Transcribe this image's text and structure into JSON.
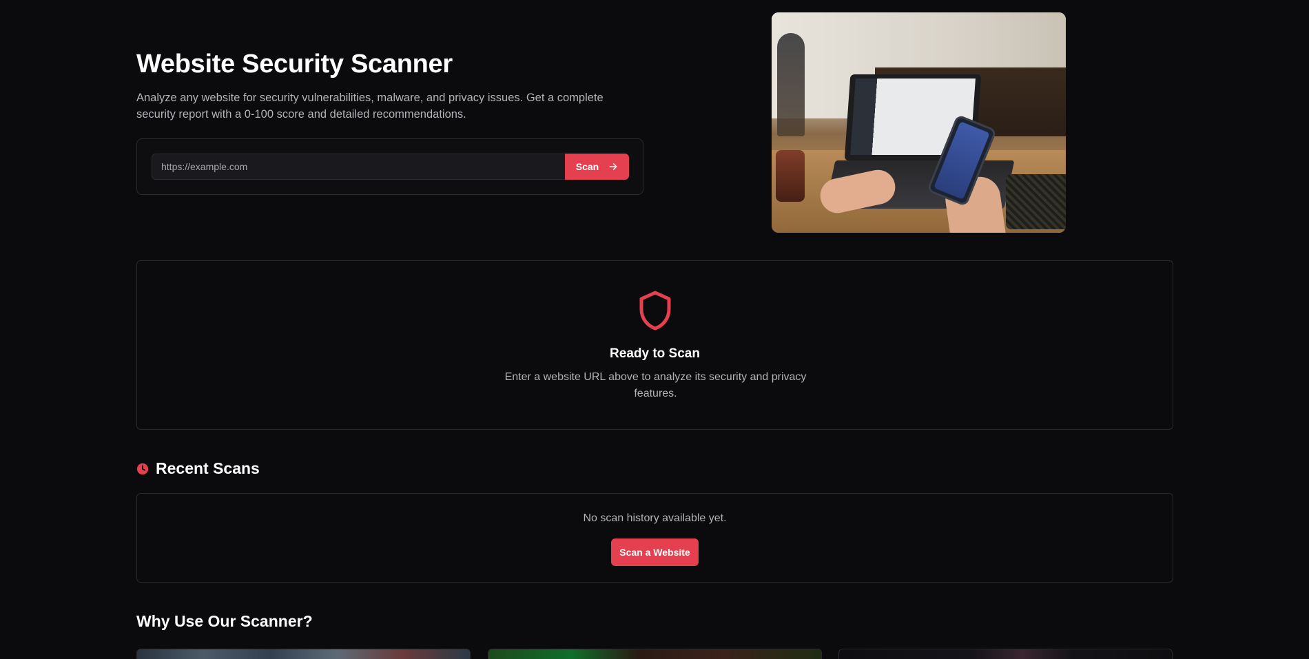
{
  "hero": {
    "title": "Website Security Scanner",
    "description": "Analyze any website for security vulnerabilities, malware, and privacy issues. Get a complete security report with a 0-100 score and detailed recommendations.",
    "url_placeholder": "https://example.com",
    "url_value": "",
    "scan_button_label": "Scan",
    "scan_button_icon": "arrow-right-icon",
    "photo_icon": "laptop-phone-photo"
  },
  "ready": {
    "icon": "shield-icon",
    "title": "Ready to Scan",
    "description": "Enter a website URL above to analyze its security and privacy features."
  },
  "recent": {
    "icon": "clock-icon",
    "title": "Recent Scans",
    "empty_text": "No scan history available yet.",
    "cta_label": "Scan a Website"
  },
  "why": {
    "title": "Why Use Our Scanner?"
  },
  "colors": {
    "accent": "#e5404f",
    "background": "#0b0b0d",
    "border": "#2a2a2f",
    "muted_text": "#b3b3b8"
  }
}
